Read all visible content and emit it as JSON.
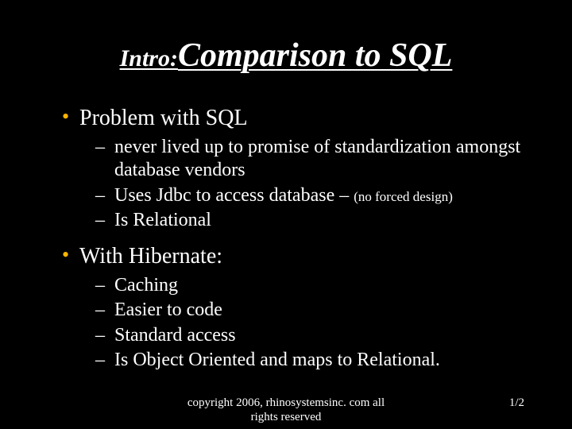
{
  "title": {
    "prefix": "Intro:",
    "main": "Comparison to SQL"
  },
  "top_items": [
    {
      "label": "Problem with SQL",
      "sub": [
        {
          "text": "never lived up to promise of standardization amongst database vendors"
        },
        {
          "text": "Uses Jdbc to access database – ",
          "note": "(no forced design)"
        },
        {
          "text": "Is Relational"
        }
      ]
    },
    {
      "label": "With Hibernate:",
      "sub": [
        {
          "text": "Caching"
        },
        {
          "text": "Easier to code"
        },
        {
          "text": "Standard access"
        },
        {
          "text": "Is Object Oriented and maps to Relational."
        }
      ]
    }
  ],
  "footer": {
    "copyright": "copyright 2006, rhinosystemsinc. com all rights reserved",
    "page": "1/2"
  }
}
